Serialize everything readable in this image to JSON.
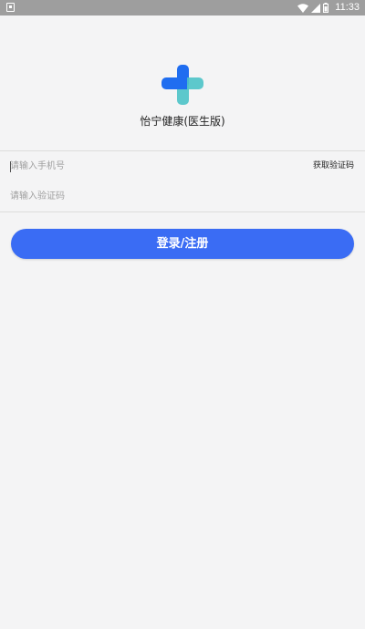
{
  "status_bar": {
    "time": "11:33",
    "icons": [
      "notification-icon",
      "wifi-icon",
      "signal-icon",
      "battery-icon"
    ]
  },
  "app": {
    "logo_icon": "medical-cross-logo",
    "name": "怡宁健康(医生版)"
  },
  "form": {
    "phone_placeholder": "请输入手机号",
    "get_code_label": "获取验证码",
    "code_placeholder": "请输入验证码",
    "submit_label": "登录/注册"
  },
  "colors": {
    "primary": "#3a6cf4",
    "background": "#f4f4f5",
    "status_bar": "#9e9e9e",
    "logo_blue": "#1f6df0",
    "logo_teal": "#4cc3c8"
  }
}
